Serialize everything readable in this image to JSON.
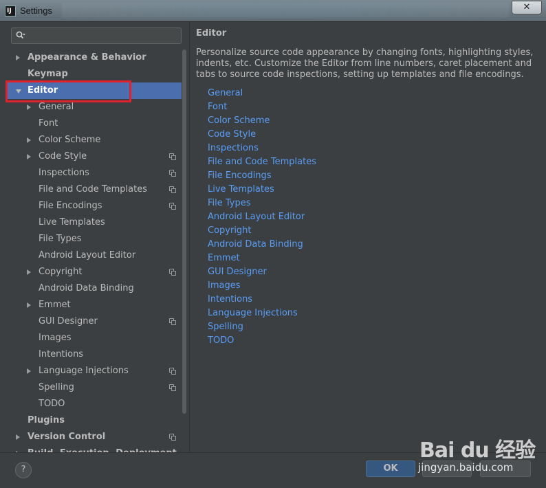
{
  "window": {
    "title": "Settings",
    "app_icon_text": "IJ",
    "close_label": "✕"
  },
  "search": {
    "placeholder": ""
  },
  "tree": [
    {
      "label": "Appearance & Behavior",
      "level": 0,
      "bold": true,
      "arrow": "right",
      "copy": false,
      "selected": false
    },
    {
      "label": "Keymap",
      "level": 0,
      "bold": true,
      "arrow": "none",
      "copy": false,
      "selected": false
    },
    {
      "label": "Editor",
      "level": 0,
      "bold": true,
      "arrow": "down",
      "copy": false,
      "selected": true
    },
    {
      "label": "General",
      "level": 1,
      "bold": false,
      "arrow": "right",
      "copy": false,
      "selected": false
    },
    {
      "label": "Font",
      "level": 1,
      "bold": false,
      "arrow": "none",
      "copy": false,
      "selected": false
    },
    {
      "label": "Color Scheme",
      "level": 1,
      "bold": false,
      "arrow": "right",
      "copy": false,
      "selected": false
    },
    {
      "label": "Code Style",
      "level": 1,
      "bold": false,
      "arrow": "right",
      "copy": true,
      "selected": false
    },
    {
      "label": "Inspections",
      "level": 1,
      "bold": false,
      "arrow": "none",
      "copy": true,
      "selected": false
    },
    {
      "label": "File and Code Templates",
      "level": 1,
      "bold": false,
      "arrow": "none",
      "copy": true,
      "selected": false
    },
    {
      "label": "File Encodings",
      "level": 1,
      "bold": false,
      "arrow": "none",
      "copy": true,
      "selected": false
    },
    {
      "label": "Live Templates",
      "level": 1,
      "bold": false,
      "arrow": "none",
      "copy": false,
      "selected": false
    },
    {
      "label": "File Types",
      "level": 1,
      "bold": false,
      "arrow": "none",
      "copy": false,
      "selected": false
    },
    {
      "label": "Android Layout Editor",
      "level": 1,
      "bold": false,
      "arrow": "none",
      "copy": false,
      "selected": false
    },
    {
      "label": "Copyright",
      "level": 1,
      "bold": false,
      "arrow": "right",
      "copy": true,
      "selected": false
    },
    {
      "label": "Android Data Binding",
      "level": 1,
      "bold": false,
      "arrow": "none",
      "copy": false,
      "selected": false
    },
    {
      "label": "Emmet",
      "level": 1,
      "bold": false,
      "arrow": "right",
      "copy": false,
      "selected": false
    },
    {
      "label": "GUI Designer",
      "level": 1,
      "bold": false,
      "arrow": "none",
      "copy": true,
      "selected": false
    },
    {
      "label": "Images",
      "level": 1,
      "bold": false,
      "arrow": "none",
      "copy": false,
      "selected": false
    },
    {
      "label": "Intentions",
      "level": 1,
      "bold": false,
      "arrow": "none",
      "copy": false,
      "selected": false
    },
    {
      "label": "Language Injections",
      "level": 1,
      "bold": false,
      "arrow": "right",
      "copy": true,
      "selected": false
    },
    {
      "label": "Spelling",
      "level": 1,
      "bold": false,
      "arrow": "none",
      "copy": true,
      "selected": false
    },
    {
      "label": "TODO",
      "level": 1,
      "bold": false,
      "arrow": "none",
      "copy": false,
      "selected": false
    },
    {
      "label": "Plugins",
      "level": 0,
      "bold": true,
      "arrow": "none",
      "copy": false,
      "selected": false
    },
    {
      "label": "Version Control",
      "level": 0,
      "bold": true,
      "arrow": "right",
      "copy": true,
      "selected": false
    },
    {
      "label": "Build, Execution, Deployment",
      "level": 0,
      "bold": true,
      "arrow": "right",
      "copy": false,
      "selected": false
    }
  ],
  "content": {
    "title": "Editor",
    "description": "Personalize source code appearance by changing fonts, highlighting styles, indents, etc. Customize the Editor from line numbers, caret placement and tabs to source code inspections, setting up templates and file encodings.",
    "links": [
      "General",
      "Font",
      "Color Scheme",
      "Code Style",
      "Inspections",
      "File and Code Templates",
      "File Encodings",
      "Live Templates",
      "File Types",
      "Android Layout Editor",
      "Copyright",
      "Android Data Binding",
      "Emmet",
      "GUI Designer",
      "Images",
      "Intentions",
      "Language Injections",
      "Spelling",
      "TODO"
    ]
  },
  "footer": {
    "help_label": "?",
    "ok_label": "OK"
  },
  "watermark": {
    "logo": "Bai du 经验",
    "url": "jingyan.baidu.com"
  },
  "colors": {
    "background": "#3c3f41",
    "selection": "#4b6eaf",
    "link": "#589df6",
    "highlight_box": "#e0222f"
  }
}
